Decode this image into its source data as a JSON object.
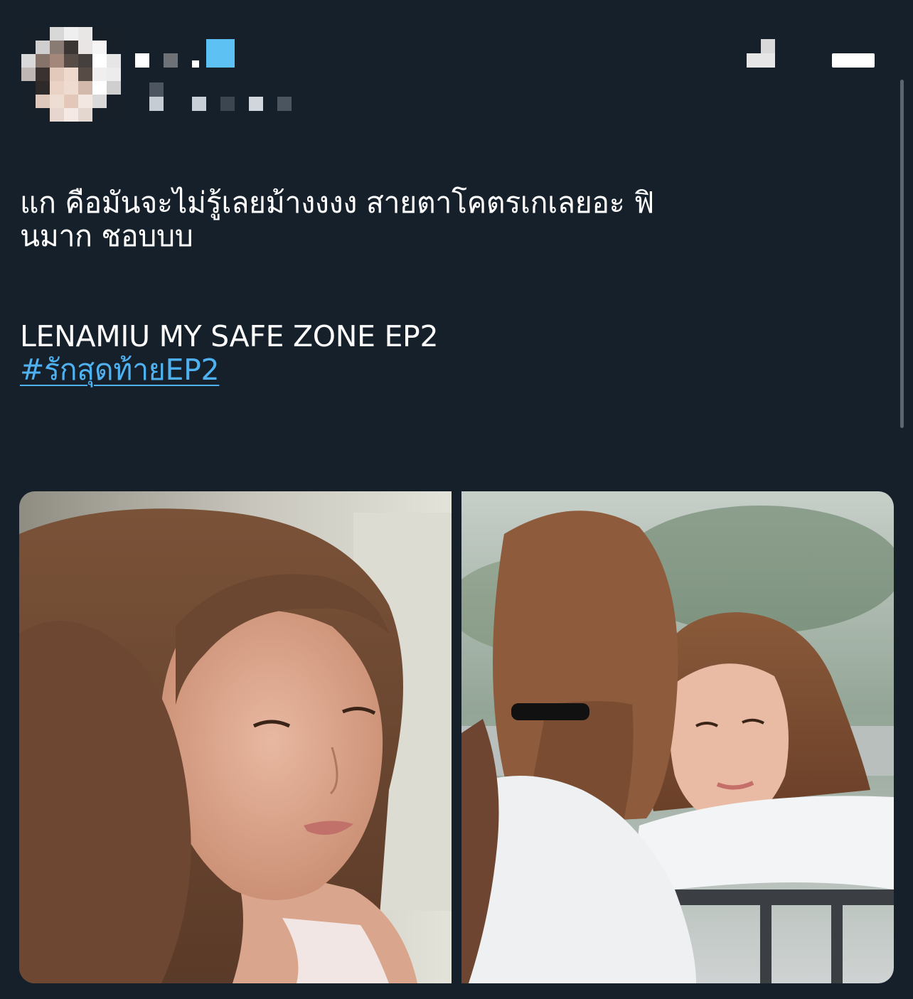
{
  "header": {
    "avatar_icon": "user-avatar-pixelated",
    "more_icon": "more-options-icon",
    "follow_icon": "follow-button-censored"
  },
  "tweet": {
    "line1": "แก คือมันจะไม่รู้เลยม้างงงง สายตาโคตรเกเลยอะ ฟิ\nนมาก ชอบบบ",
    "line2": "LENAMIU MY SAFE ZONE EP2",
    "hashtag": "#รักสุดท้ายEP2"
  },
  "media": {
    "photos": [
      {
        "icon": "photo-woman-closeup"
      },
      {
        "icon": "photo-two-women-bench"
      }
    ]
  },
  "colors": {
    "background": "#15202b",
    "text": "#ffffff",
    "link": "#4fb1f0"
  }
}
